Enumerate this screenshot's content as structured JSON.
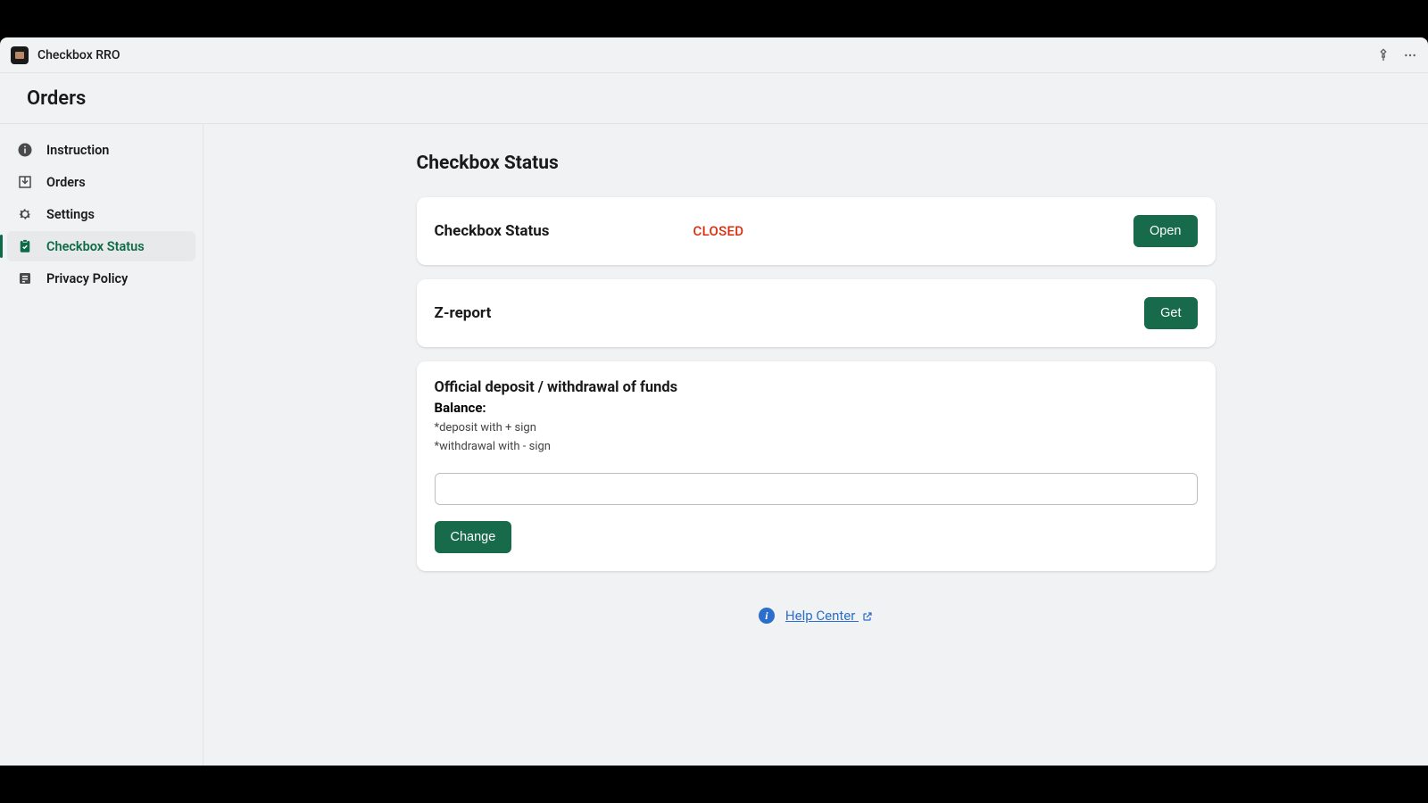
{
  "titlebar": {
    "appName": "Checkbox RRO"
  },
  "subheader": {
    "title": "Orders"
  },
  "sidebar": {
    "items": [
      {
        "label": "Instruction"
      },
      {
        "label": "Orders"
      },
      {
        "label": "Settings"
      },
      {
        "label": "Checkbox Status"
      },
      {
        "label": "Privacy Policy"
      }
    ]
  },
  "main": {
    "pageTitle": "Checkbox Status",
    "statusCard": {
      "label": "Checkbox Status",
      "status": "CLOSED",
      "buttonLabel": "Open"
    },
    "zReport": {
      "label": "Z-report",
      "buttonLabel": "Get"
    },
    "funds": {
      "title": "Official deposit / withdrawal of funds",
      "balanceLabel": "Balance:",
      "hint1": "*deposit with + sign",
      "hint2": "*withdrawal with - sign",
      "inputValue": "",
      "buttonLabel": "Change"
    },
    "help": {
      "label": "Help Center "
    }
  }
}
